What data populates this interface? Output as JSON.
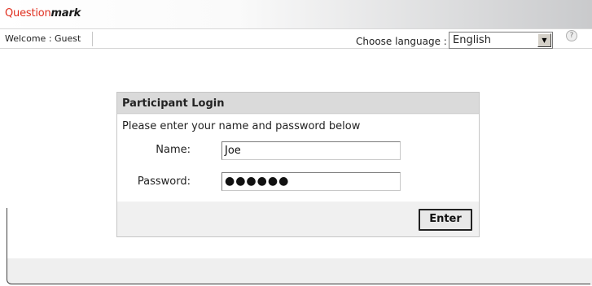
{
  "header": {
    "logo_part1": "Question",
    "logo_part2": "mark"
  },
  "info_bar": {
    "welcome_text": "Welcome : Guest",
    "language_label": "Choose language :",
    "language_value": "English",
    "help_symbol": "?"
  },
  "login": {
    "title": "Participant Login",
    "instruction": "Please enter your name and password below",
    "name_label": "Name:",
    "name_value": "Joe",
    "password_label": "Password:",
    "password_mask": "●●●●●●",
    "enter_label": "Enter"
  },
  "colors": {
    "logo_accent": "#e03020",
    "header_bg": "#dadada",
    "panel_bg": "#f0f0f0"
  }
}
